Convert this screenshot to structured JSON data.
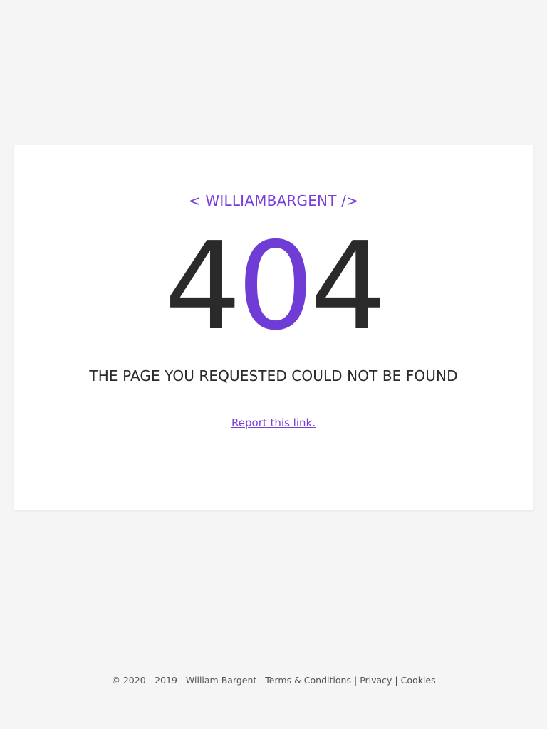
{
  "brand": {
    "text": "< WILLIAMBARGENT />"
  },
  "error": {
    "digit1": "4",
    "digit2": "0",
    "digit3": "4"
  },
  "message": "THE PAGE YOU REQUESTED COULD NOT BE FOUND",
  "report_link": "Report this link.",
  "footer": {
    "copyright": "© 2020 - 2019",
    "owner": "William Bargent",
    "terms": "Terms & Conditions",
    "privacy": "Privacy",
    "cookies": "Cookies",
    "separator": "|"
  },
  "colors": {
    "background": "#f5f5f5",
    "card": "#ffffff",
    "accent": "#7a3fdb",
    "text": "#2a2a2a"
  }
}
